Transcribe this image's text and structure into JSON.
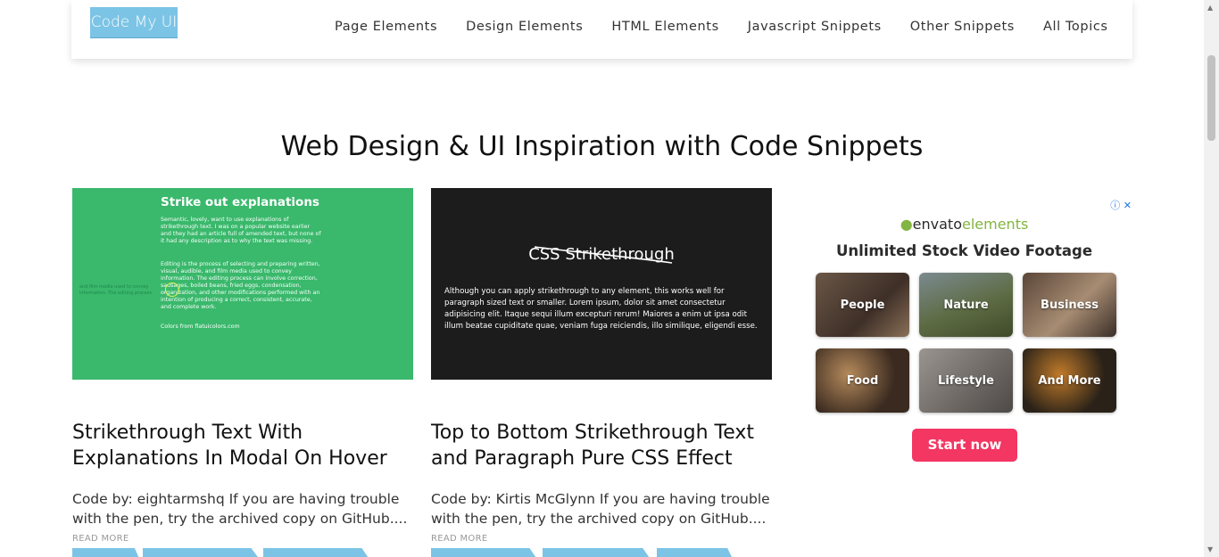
{
  "header": {
    "logo": "Code My UI",
    "nav": [
      "Page Elements",
      "Design Elements",
      "HTML Elements",
      "Javascript Snippets",
      "Other Snippets",
      "All Topics"
    ]
  },
  "page_title": "Web Design & UI Inspiration with Code Snippets",
  "cards": [
    {
      "thumb": {
        "title": "Strike out explanations",
        "p1": "Semantic, lovely, want to use explanations of strikethrough text. I was on a popular website earlier and they had an article full of amended text, but none of it had any description as to why the text was missing.",
        "p2": "Editing is the process of selecting and preparing written, visual, audible, and film media used to convey information. The editing process can involve correction, sausages, boiled beans, fried eggs, condensation, organization, and other modifications performed with an intention of producing a correct, consistent, accurate, and complete work.",
        "side": "and film media used to convey information. The editing process",
        "colors": "Colors from flatuicolors.com"
      },
      "title": "Strikethrough Text With Explanations In Modal On Hover",
      "desc": "Code by: eightarmshq If you are having trouble with the pen, try the archived copy on GitHub....",
      "read_more": "READ MORE"
    },
    {
      "thumb": {
        "title": "CSS Strikethrough",
        "p": "Although you can apply strikethrough to any element, this works well for paragraph sized text or smaller. Lorem ipsum, dolor sit amet consectetur adipisicing elit. Itaque sequi illum excepturi rerum! Maiores a enim ut ipsa odit illum beatae cupiditate quae, veniam fuga reiciendis, illo similique, eligendi esse."
      },
      "title": "Top to Bottom Strikethrough Text and Paragraph Pure CSS Effect",
      "desc": "Code by: Kirtis McGlynn If you are having trouble with the pen, try the archived copy on GitHub....",
      "read_more": "READ MORE"
    }
  ],
  "ad": {
    "close": "ⓘ ✕",
    "brand_a": "envato",
    "brand_b": "elements",
    "headline": "Unlimited Stock Video Footage",
    "tiles": [
      "People",
      "Nature",
      "Business",
      "Food",
      "Lifestyle",
      "And More"
    ],
    "cta": "Start now"
  },
  "colors": {
    "accent": "#7cc4e5",
    "green_thumb": "#3ab86c",
    "cta": "#f33662"
  }
}
